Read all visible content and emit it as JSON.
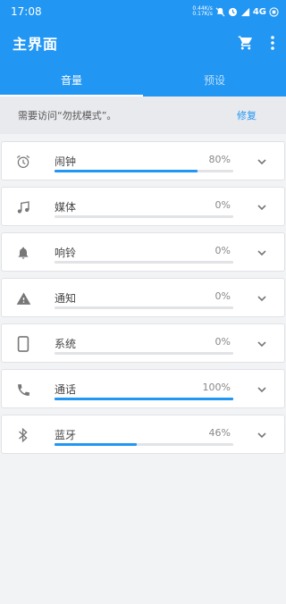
{
  "status_bar": {
    "time": "17:08",
    "net_up": "0.44K/s",
    "net_down": "0.17K/s",
    "network": "4G"
  },
  "app_bar": {
    "title": "主界面",
    "cart_icon": "cart-icon",
    "menu_icon": "more-vert-icon"
  },
  "tabs": [
    {
      "label": "音量",
      "active": true
    },
    {
      "label": "预设",
      "active": false
    }
  ],
  "notice": {
    "text": "需要访问“勿扰模式”。",
    "action": "修复"
  },
  "channels": [
    {
      "label": "闹钟",
      "percent_text": "80%",
      "value": 0.8,
      "icon": "alarm-icon"
    },
    {
      "label": "媒体",
      "percent_text": "0%",
      "value": 0.0,
      "icon": "music-note-icon"
    },
    {
      "label": "响铃",
      "percent_text": "0%",
      "value": 0.0,
      "icon": "bell-icon"
    },
    {
      "label": "通知",
      "percent_text": "0%",
      "value": 0.0,
      "icon": "warning-icon"
    },
    {
      "label": "系统",
      "percent_text": "0%",
      "value": 0.0,
      "icon": "phone-device-icon"
    },
    {
      "label": "通话",
      "percent_text": "100%",
      "value": 1.0,
      "icon": "call-icon"
    },
    {
      "label": "蓝牙",
      "percent_text": "46%",
      "value": 0.46,
      "icon": "bluetooth-icon"
    }
  ],
  "colors": {
    "accent": "#2196f3",
    "background": "#f2f3f5"
  }
}
